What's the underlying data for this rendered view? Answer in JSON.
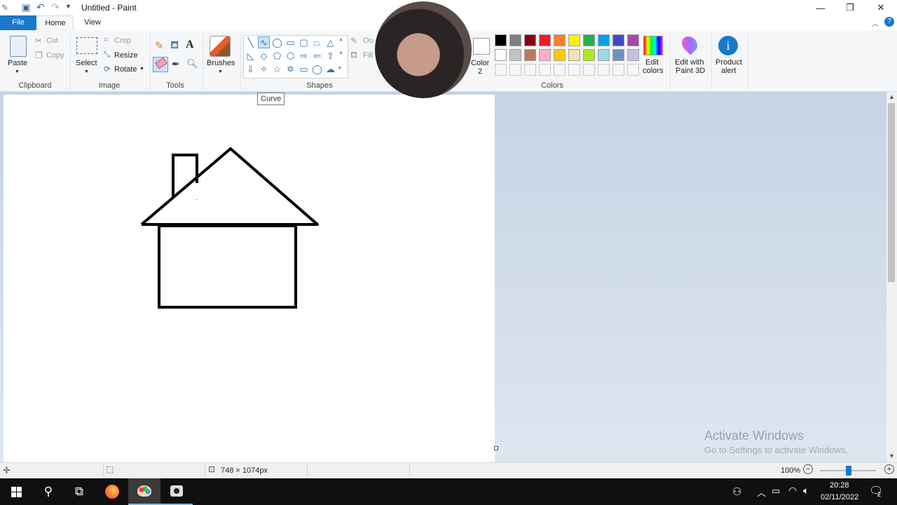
{
  "window": {
    "title": "Untitled - Paint"
  },
  "tabs": [
    {
      "label": "File"
    },
    {
      "label": "Home"
    },
    {
      "label": "View"
    }
  ],
  "clipboard": {
    "paste": "Paste",
    "cut": "Cut",
    "copy": "Copy",
    "group": "Clipboard"
  },
  "image": {
    "select": "Select",
    "crop": "Crop",
    "resize": "Resize",
    "rotate": "Rotate",
    "group": "Image"
  },
  "tools": {
    "group": "Tools"
  },
  "brushes": {
    "label": "Brushes"
  },
  "shapes": {
    "outline": "Ou",
    "fill": "Fill",
    "group": "Shapes",
    "tooltip": "Curve"
  },
  "colors": {
    "color2_line1": "Color",
    "color2_line2": "2",
    "edit_line1": "Edit",
    "edit_line2": "colors",
    "group": "Colors",
    "palette_row1": [
      "#000000",
      "#7f7f7f",
      "#880015",
      "#ed1c24",
      "#ff7f27",
      "#fff200",
      "#22b14c",
      "#00a2e8",
      "#3f48cc",
      "#a349a4"
    ],
    "palette_row2": [
      "#ffffff",
      "#c3c3c3",
      "#b97a57",
      "#ffaec9",
      "#ffc90e",
      "#efe4b0",
      "#b5e61d",
      "#99d9ea",
      "#7092be",
      "#c8bfe7"
    ]
  },
  "paint3d": {
    "line1": "Edit with",
    "line2": "Paint 3D"
  },
  "product_alert": {
    "line1": "Product",
    "line2": "alert"
  },
  "status": {
    "size": "748 × 1074px",
    "zoom": "100%"
  },
  "watermark": {
    "line1": "Activate Windows",
    "line2": "Go to Settings to activate Windows."
  },
  "taskbar": {
    "time": "20:28",
    "date": "02/11/2022",
    "notifications": "2"
  }
}
